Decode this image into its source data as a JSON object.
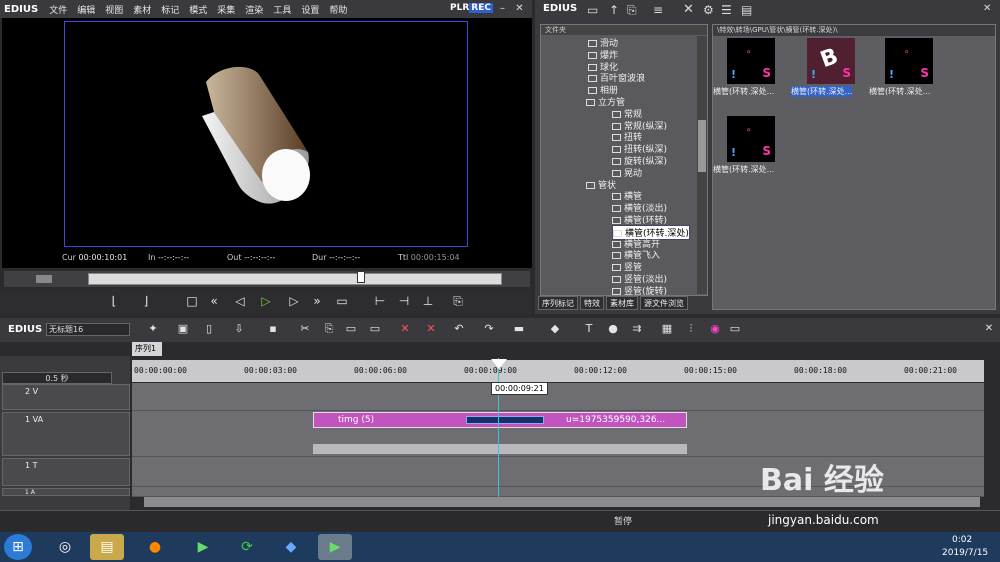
{
  "app": {
    "logo": "EDIUS",
    "plr": "PLR",
    "rec": "REC"
  },
  "menu": [
    "文件",
    "编辑",
    "视图",
    "素材",
    "标记",
    "模式",
    "采集",
    "渲染",
    "工具",
    "设置",
    "帮助"
  ],
  "preview": {
    "cur_label": "Cur",
    "cur": "00:00:10:01",
    "in_label": "In",
    "in": "--:--:--:--",
    "out_label": "Out",
    "out": "--:--:--:--",
    "dur_label": "Dur",
    "dur": "--:--:--:--",
    "ttl_label": "Ttl",
    "ttl": "00:00:15:04"
  },
  "right_panel": {
    "logo": "EDIUS",
    "tree_header": "文件夹",
    "bin_path": "\\特效\\转场\\GPU\\管状\\横管(环转.深处)\\",
    "tabs": [
      "序列标记",
      "特效",
      "素材库",
      "源文件浏览"
    ]
  },
  "tree": [
    {
      "label": "滑动",
      "level": 1
    },
    {
      "label": "爆炸",
      "level": 1
    },
    {
      "label": "球化",
      "level": 1
    },
    {
      "label": "百叶窗波浪",
      "level": 1
    },
    {
      "label": "相册",
      "level": 1
    },
    {
      "label": "立方管",
      "level": 0
    },
    {
      "label": "常规",
      "level": 2
    },
    {
      "label": "常规(纵深)",
      "level": 2
    },
    {
      "label": "扭转",
      "level": 2
    },
    {
      "label": "扭转(纵深)",
      "level": 2
    },
    {
      "label": "旋转(纵深)",
      "level": 2
    },
    {
      "label": "晃动",
      "level": 2
    },
    {
      "label": "管状",
      "level": 0
    },
    {
      "label": "横管",
      "level": 2
    },
    {
      "label": "横管(淡出)",
      "level": 2
    },
    {
      "label": "横管(环转)",
      "level": 2
    },
    {
      "label": "横管(环转.深处)",
      "level": 2,
      "selected": true
    },
    {
      "label": "横管高开",
      "level": 2
    },
    {
      "label": "横管飞入",
      "level": 2
    },
    {
      "label": "竖管",
      "level": 2
    },
    {
      "label": "竖管(淡出)",
      "level": 2
    },
    {
      "label": "竖管(旋转)",
      "level": 2
    }
  ],
  "thumbs": [
    {
      "label": "横管(环转.深处..."
    },
    {
      "label": "横管(环转.深处...",
      "selected": true
    },
    {
      "label": "横管(环转.深处..."
    },
    {
      "label": "横管(环转.深处..."
    }
  ],
  "timeline": {
    "logo": "EDIUS",
    "project": "无标题16",
    "sequence": "序列1",
    "scale": "0.5 秒",
    "ruler": [
      "00:00:00:00",
      "00:00:03:00",
      "00:00:06:00",
      "00:00:09:00",
      "00:00:12:00",
      "00:00:15:00",
      "00:00:18:00",
      "00:00:21:00"
    ],
    "playhead_tip": "00:00:09:21",
    "tracks": [
      {
        "name": "2 V"
      },
      {
        "name": "1 VA"
      },
      {
        "name": "1 T"
      },
      {
        "name": "1 A"
      }
    ],
    "clip_left": "timg (5)",
    "clip_right": "u=1975359590,326...",
    "status": "暂停"
  },
  "taskbar": {
    "time": "0:02",
    "date": "2019/7/15"
  },
  "watermark": {
    "text": "Bai 经验",
    "url": "jingyan.baidu.com"
  }
}
